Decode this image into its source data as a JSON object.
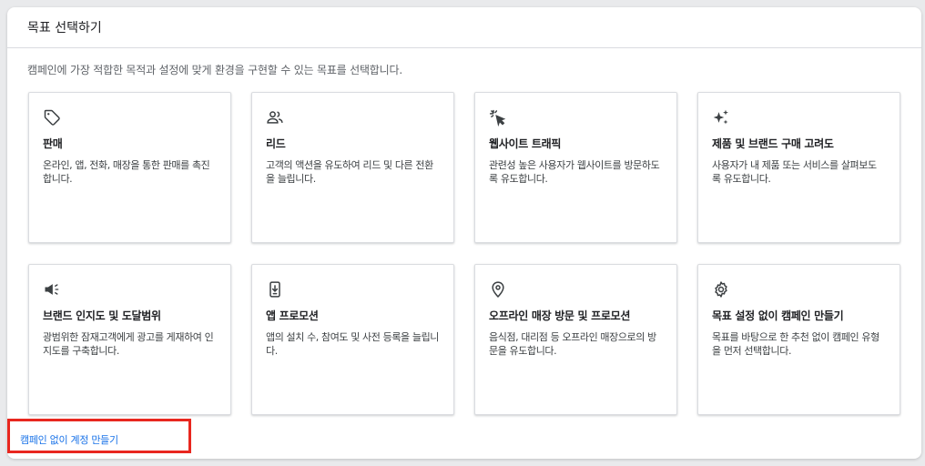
{
  "header": {
    "title": "목표 선택하기"
  },
  "subtitle": "캠페인에 가장 적합한 목적과 설정에 맞게 환경을 구현할 수 있는 목표를 선택합니다.",
  "cards": [
    {
      "icon": "tag-icon",
      "title": "판매",
      "desc": "온라인, 앱, 전화, 매장을 통한 판매를 촉진합니다."
    },
    {
      "icon": "people-icon",
      "title": "리드",
      "desc": "고객의 액션을 유도하여 리드 및 다른 전환을 늘립니다."
    },
    {
      "icon": "cursor-click-icon",
      "title": "웹사이트 트래픽",
      "desc": "관련성 높은 사용자가 웹사이트를 방문하도록 유도합니다."
    },
    {
      "icon": "sparkle-icon",
      "title": "제품 및 브랜드 구매 고려도",
      "desc": "사용자가 내 제품 또는 서비스를 살펴보도록 유도합니다."
    },
    {
      "icon": "megaphone-icon",
      "title": "브랜드 인지도 및 도달범위",
      "desc": "광범위한 잠재고객에게 광고를 게재하여 인지도를 구축합니다."
    },
    {
      "icon": "phone-download-icon",
      "title": "앱 프로모션",
      "desc": "앱의 설치 수, 참여도 및 사전 등록을 늘립니다."
    },
    {
      "icon": "location-pin-icon",
      "title": "오프라인 매장 방문 및 프로모션",
      "desc": "음식점, 대리점 등 오프라인 매장으로의 방문을 유도합니다."
    },
    {
      "icon": "gear-icon",
      "title": "목표 설정 없이 캠페인 만들기",
      "desc": "목표를 바탕으로 한 추천 없이 캠페인 유형을 먼저 선택합니다."
    }
  ],
  "footer_link": "캠페인 없이 계정 만들기",
  "colors": {
    "link": "#1a73e8",
    "highlight_border": "#e8271f",
    "icon": "#3c4043"
  }
}
